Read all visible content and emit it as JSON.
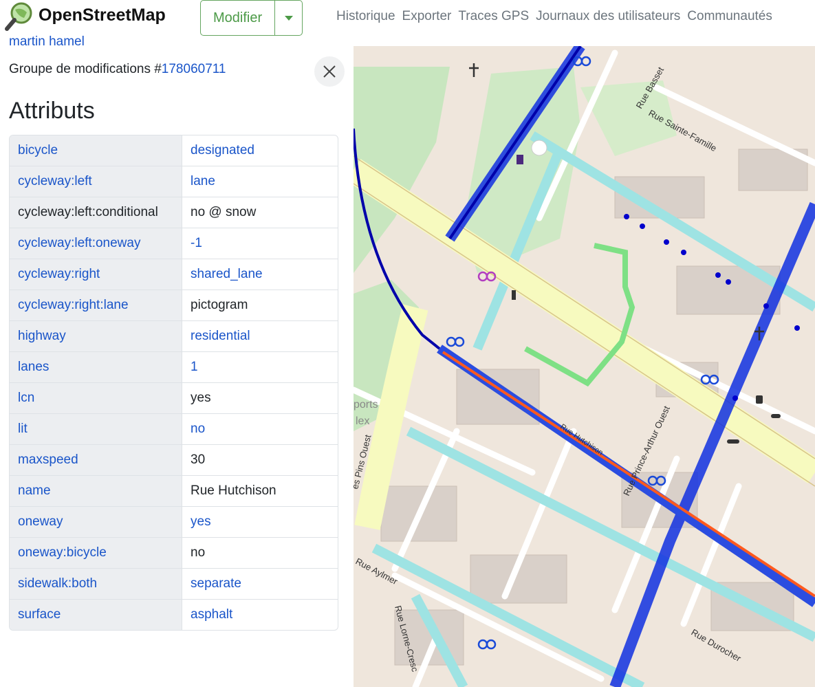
{
  "header": {
    "brand": "OpenStreetMap",
    "edit_label": "Modifier",
    "nav": [
      "Historique",
      "Exporter",
      "Traces GPS",
      "Journaux des utilisateurs",
      "Communautés"
    ]
  },
  "sidebar": {
    "author": "martin hamel",
    "changeset_prefix": "Groupe de modifications #",
    "changeset_id": "178060711",
    "title": "Attributs",
    "tags": [
      {
        "key": "bicycle",
        "value": "designated",
        "key_link": true,
        "value_link": true
      },
      {
        "key": "cycleway:left",
        "value": "lane",
        "key_link": true,
        "value_link": true
      },
      {
        "key": "cycleway:left:conditional",
        "value": "no @ snow",
        "key_link": false,
        "value_link": false
      },
      {
        "key": "cycleway:left:oneway",
        "value": "-1",
        "key_link": true,
        "value_link": true
      },
      {
        "key": "cycleway:right",
        "value": "shared_lane",
        "key_link": true,
        "value_link": true
      },
      {
        "key": "cycleway:right:lane",
        "value": "pictogram",
        "key_link": true,
        "value_link": false
      },
      {
        "key": "highway",
        "value": "residential",
        "key_link": true,
        "value_link": true
      },
      {
        "key": "lanes",
        "value": "1",
        "key_link": true,
        "value_link": true
      },
      {
        "key": "lcn",
        "value": "yes",
        "key_link": true,
        "value_link": false
      },
      {
        "key": "lit",
        "value": "no",
        "key_link": true,
        "value_link": true
      },
      {
        "key": "maxspeed",
        "value": "30",
        "key_link": true,
        "value_link": false
      },
      {
        "key": "name",
        "value": "Rue Hutchison",
        "key_link": true,
        "value_link": false
      },
      {
        "key": "oneway",
        "value": "yes",
        "key_link": true,
        "value_link": true
      },
      {
        "key": "oneway:bicycle",
        "value": "no",
        "key_link": true,
        "value_link": false
      },
      {
        "key": "sidewalk:both",
        "value": "separate",
        "key_link": true,
        "value_link": true
      },
      {
        "key": "surface",
        "value": "asphalt",
        "key_link": true,
        "value_link": true
      }
    ]
  },
  "map": {
    "labels": {
      "basset": "Rue Basset",
      "sainte_famille": "Rue Sainte-Famille",
      "pins": "es Pins Ouest",
      "prince_arthur": "Rue Prince-Arthur Ouest",
      "aylmer": "Rue Aylmer",
      "lorne": "Rue Lorne-Cresc",
      "durocher": "Rue Durocher",
      "hutchison": "Rue Hutchison",
      "ports": "ports",
      "lex": "lex"
    }
  },
  "colors": {
    "accent": "#1a55c9",
    "edit_green": "#4c9a47",
    "cycleway_blue": "#0000ff",
    "highlight_orange": "#ff5a1e",
    "primary_road": "#f7fabf"
  },
  "icons": [
    "search-logo-icon",
    "chevron-down-icon",
    "close-icon"
  ]
}
